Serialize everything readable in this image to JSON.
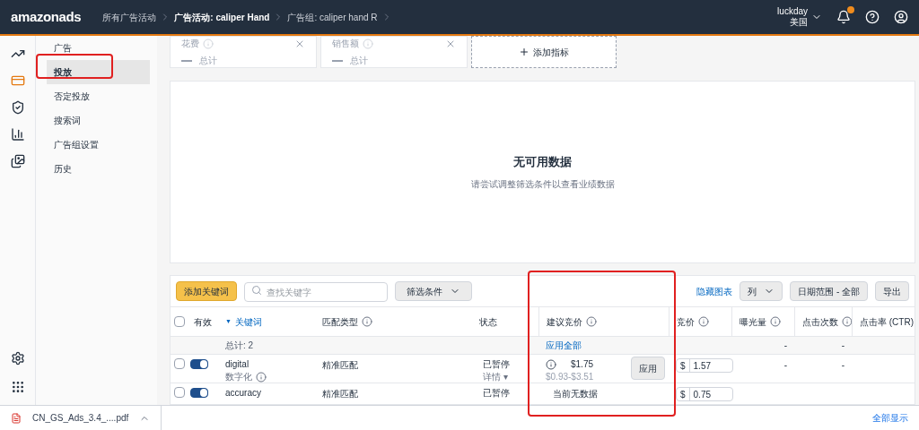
{
  "header": {
    "logo": "amazonads",
    "breadcrumbs": [
      {
        "label": "所有广告活动",
        "bold": false
      },
      {
        "label": "广告活动: caliper Hand",
        "bold": true
      },
      {
        "label": "广告组: caliper hand R",
        "bold": false
      }
    ],
    "account": {
      "name": "luckday",
      "region": "美国"
    },
    "notification_dot": true
  },
  "rail": [
    {
      "kind": "chart",
      "selected": false
    },
    {
      "kind": "campaign",
      "selected": true
    },
    {
      "kind": "shield",
      "selected": false
    },
    {
      "kind": "bars",
      "selected": false
    },
    {
      "kind": "media",
      "selected": false
    }
  ],
  "rail_bottom": [
    {
      "kind": "settings"
    },
    {
      "kind": "apps"
    }
  ],
  "nav": [
    {
      "label": "广告",
      "selected": false
    },
    {
      "label": "投放",
      "selected": true,
      "highlighted": true
    },
    {
      "label": "否定投放",
      "selected": false
    },
    {
      "label": "搜索词",
      "selected": false
    },
    {
      "label": "广告组设置",
      "selected": false
    },
    {
      "label": "历史",
      "selected": false
    }
  ],
  "metric_cards": [
    {
      "label": "花费",
      "total": "总计"
    },
    {
      "label": "销售额",
      "total": "总计"
    }
  ],
  "add_metric": "添加指标",
  "chart_empty": {
    "title": "无可用数据",
    "subtitle": "请尝试调整筛选条件以查看业绩数据"
  },
  "toolbar": {
    "add_button": "添加关键词",
    "search_placeholder": "查找关键字",
    "filter": "筛选条件",
    "hide_chart": "隐藏图表",
    "columns": "列",
    "date_range": "日期范围 - 全部",
    "export": "导出"
  },
  "table": {
    "select_all": {
      "checked": false
    },
    "columns": [
      {
        "label": "有效",
        "info": false
      },
      {
        "label": "关键词",
        "info": false,
        "sort_marker": "▼"
      },
      {
        "label": "匹配类型",
        "info": true
      },
      {
        "label": "状态",
        "info": false
      },
      {
        "label": "建议竞价",
        "info": true,
        "highlighted": true
      },
      {
        "label": "竞价",
        "info": true
      },
      {
        "label": "曝光量",
        "info": true
      },
      {
        "label": "点击次数",
        "info": true
      },
      {
        "label": "点击率 (CTR)",
        "info": false
      }
    ],
    "total_row": {
      "label": "总计: 2",
      "apply_all": "应用全部",
      "impressions": "-",
      "clicks": "-"
    },
    "rows": [
      {
        "checked": false,
        "enabled": true,
        "keyword": "digital",
        "translation": "数字化",
        "match": "精准匹配",
        "status": "已暂停",
        "status_link": "详情 ▾",
        "suggested": {
          "kind": "bid",
          "value": "$1.75",
          "range": "$0.93-$3.51",
          "apply": "应用"
        },
        "currency": "$",
        "bid": "1.57",
        "impressions": "-",
        "clicks": "-"
      },
      {
        "checked": false,
        "enabled": true,
        "keyword": "accuracy",
        "match": "精准匹配",
        "status": "已暂停",
        "suggested": {
          "kind": "none",
          "text": "当前无数据"
        },
        "currency": "$",
        "bid": "0.75"
      }
    ]
  },
  "download_bar": {
    "file": "CN_GS_Ads_3.4_....pdf",
    "show_all": "全部显示"
  }
}
